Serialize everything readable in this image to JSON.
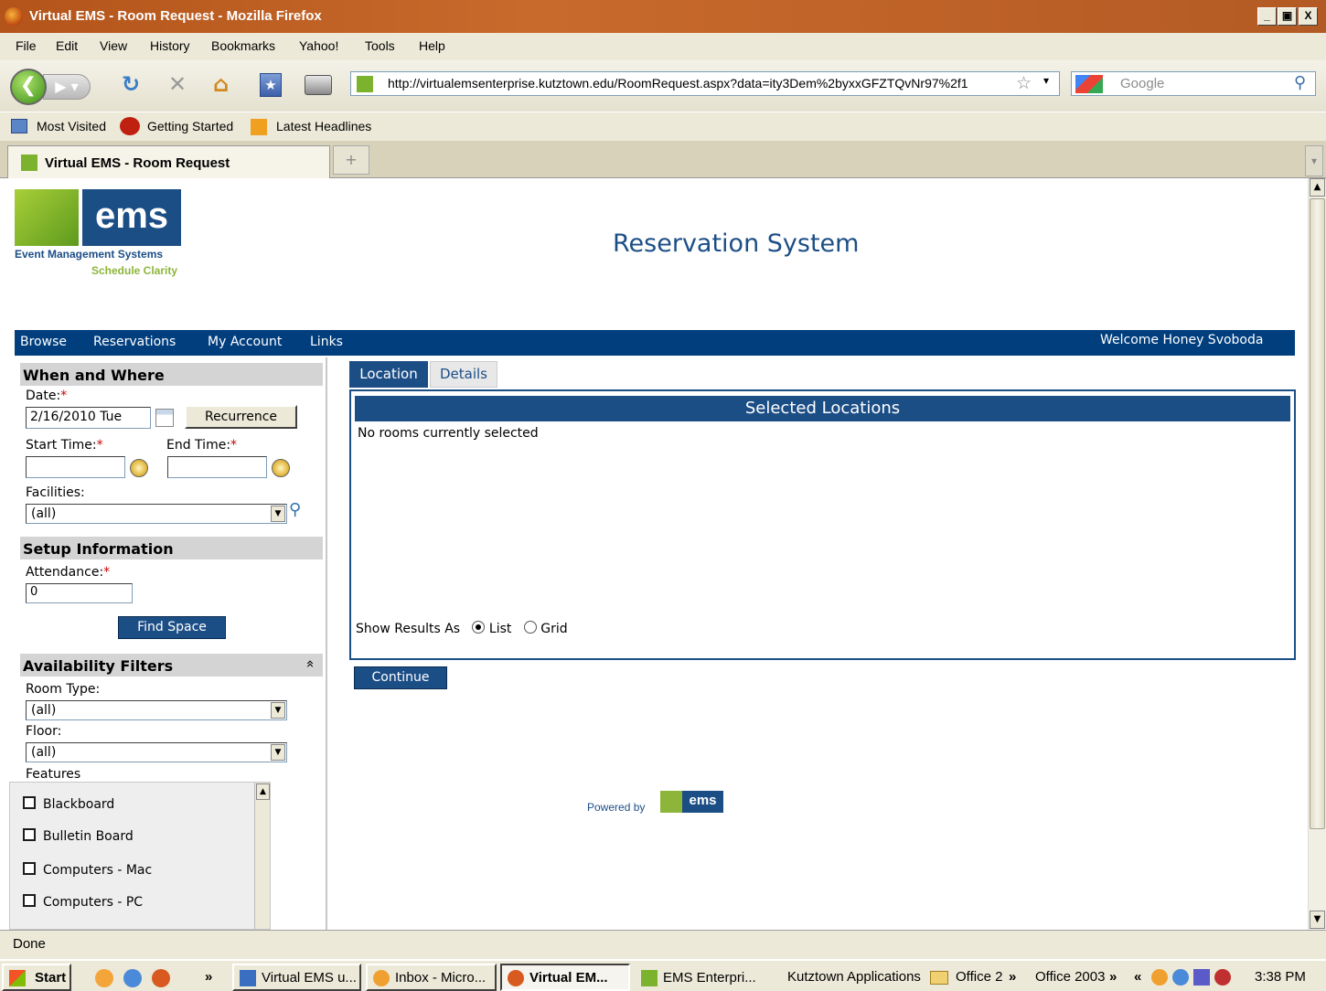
{
  "window": {
    "title": "Virtual EMS - Room Request - Mozilla Firefox",
    "min": "_",
    "max": "¸",
    "close": "X"
  },
  "menu": [
    "File",
    "Edit",
    "View",
    "History",
    "Bookmarks",
    "Yahoo!",
    "Tools",
    "Help"
  ],
  "nav": {
    "url": "http://virtualemsenterprise.kutztown.edu/RoomRequest.aspx?data=ity3Dem%2byxxGFZTQvNr97%2f1",
    "search_placeholder": "Google"
  },
  "bookmarks": [
    "Most Visited",
    "Getting Started",
    "Latest Headlines"
  ],
  "tab": {
    "title": "Virtual EMS - Room Request",
    "new_tab": "+"
  },
  "logo": {
    "word": "ems",
    "line1": "Event Management Systems",
    "line2": "Schedule Clarity"
  },
  "page_title": "Reservation System",
  "topnav": {
    "items": [
      "Browse",
      "Reservations",
      "My Account",
      "Links"
    ],
    "welcome": "Welcome Honey Svoboda"
  },
  "when_where": {
    "header": "When and Where",
    "date_label": "Date:",
    "date_value": "2/16/2010 Tue",
    "recurrence": "Recurrence",
    "start_label": "Start Time:",
    "end_label": "End Time:",
    "start_value": "",
    "end_value": "",
    "facilities_label": "Facilities:",
    "facilities_value": "(all)",
    "required_mark": "*"
  },
  "setup": {
    "header": "Setup Information",
    "attendance_label": "Attendance:",
    "attendance_value": "0",
    "find_space": "Find Space"
  },
  "filters": {
    "header": "Availability Filters",
    "collapse": "»",
    "room_type_label": "Room Type:",
    "room_type_value": "(all)",
    "floor_label": "Floor:",
    "floor_value": "(all)",
    "features_label": "Features",
    "features": [
      "Blackboard",
      "Bulletin Board",
      "Computers - Mac",
      "Computers - PC"
    ]
  },
  "main": {
    "tabs": [
      "Location",
      "Details"
    ],
    "selected_header": "Selected Locations",
    "empty_text": "No rooms currently selected",
    "show_results": "Show Results As",
    "options": [
      "List",
      "Grid"
    ],
    "selected_option": "List",
    "continue": "Continue",
    "powered_by": "Powered by",
    "powered_logo": "ems"
  },
  "status": "Done",
  "taskbar": {
    "start": "Start",
    "overflow": "»",
    "tasks": [
      "Virtual EMS u...",
      "Inbox - Micro...",
      "Virtual EM...",
      "EMS Enterpri..."
    ],
    "active_task": "Virtual EM...",
    "toolbar_items": [
      "Kutztown Applications",
      "Office 2",
      "Office 2003"
    ],
    "tray_left": "«",
    "clock": "3:38 PM"
  }
}
